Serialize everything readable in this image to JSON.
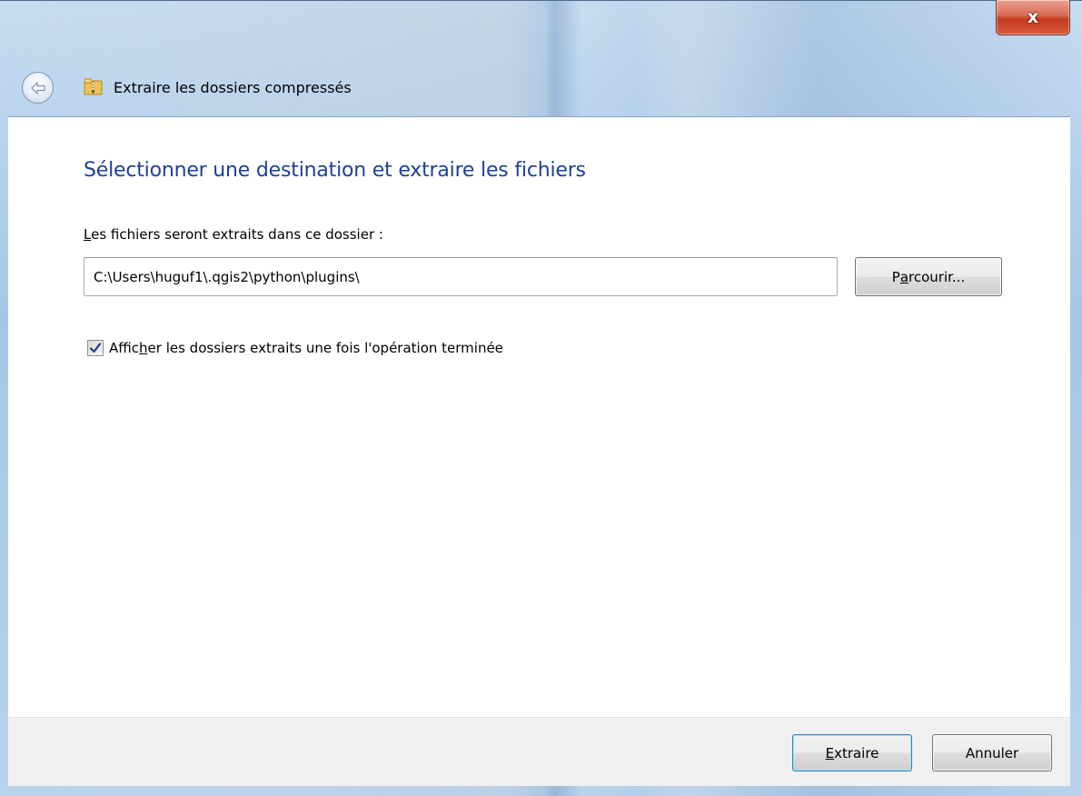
{
  "window": {
    "close_glyph": "x",
    "nav_title": "Extraire les dossiers compressés"
  },
  "main": {
    "heading": "Sélectionner une destination et extraire les fichiers",
    "dest_label_accel": "L",
    "dest_label_rest": "es fichiers seront extraits dans ce dossier :",
    "path_value": "C:\\Users\\huguf1\\.qgis2\\python\\plugins\\",
    "browse_pre": "P",
    "browse_accel": "a",
    "browse_post": "rcourir...",
    "checkbox_checked": true,
    "checkbox_label_pre": "Affic",
    "checkbox_label_accel": "h",
    "checkbox_label_post": "er les dossiers extraits une fois l'opération terminée"
  },
  "footer": {
    "extract_accel": "E",
    "extract_rest": "xtraire",
    "cancel_label": "Annuler"
  },
  "colors": {
    "heading": "#1e3f9a",
    "frame": "#b9d3ec",
    "close_button": "#c3391f"
  },
  "icons": {
    "back": "back-arrow-icon",
    "zip": "zip-folder-icon",
    "check": "checkmark-icon"
  }
}
